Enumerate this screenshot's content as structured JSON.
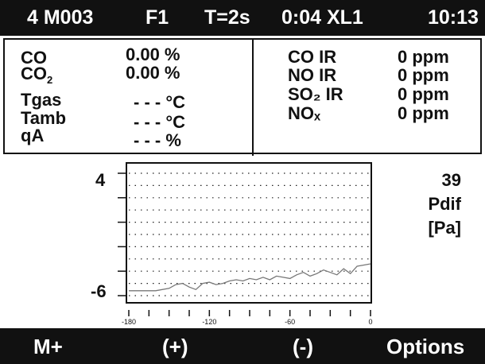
{
  "status": {
    "memory": "4 M003",
    "fuel": "F1",
    "interval": "T=2s",
    "elapsed": "0:04 XL1",
    "clock": "10:13"
  },
  "left_readings": [
    {
      "name": "CO",
      "sub": "",
      "value": "0.00 %"
    },
    {
      "name": "CO",
      "sub": "2",
      "value": "0.00 %"
    },
    {
      "name": "Tgas",
      "sub": "",
      "value": "- - - °C"
    },
    {
      "name": "Tamb",
      "sub": "",
      "value": "- - - °C"
    },
    {
      "name": "qA",
      "sub": "",
      "value": "- - - %"
    }
  ],
  "right_readings": [
    {
      "name": "CO IR",
      "value": "0 ppm"
    },
    {
      "name": "NO IR",
      "value": "0 ppm"
    },
    {
      "name": "SO₂ IR",
      "value": "0 ppm"
    },
    {
      "name": "NOₓ",
      "value": "0 ppm"
    }
  ],
  "graph": {
    "current_value": "39",
    "parameter": "Pdif",
    "unit": "[Pa]"
  },
  "chart_data": {
    "type": "line",
    "x_tick_labels": [
      "-180",
      "-120",
      "-60",
      "0"
    ],
    "y_tick_labels": [
      "4",
      "-6"
    ],
    "xlim": [
      -180,
      0
    ],
    "ylim": [
      -6,
      4
    ],
    "x": [
      -180,
      -170,
      -160,
      -150,
      -145,
      -140,
      -135,
      -130,
      -125,
      -120,
      -115,
      -110,
      -105,
      -100,
      -95,
      -90,
      -85,
      -80,
      -75,
      -70,
      -65,
      -60,
      -55,
      -50,
      -45,
      -40,
      -35,
      -30,
      -25,
      -20,
      -15,
      -10,
      -5,
      0
    ],
    "y": [
      -5.6,
      -5.6,
      -5.6,
      -5.4,
      -5.1,
      -5.0,
      -5.3,
      -5.5,
      -5.0,
      -4.9,
      -5.1,
      -5.0,
      -4.8,
      -4.7,
      -4.8,
      -4.6,
      -4.7,
      -4.5,
      -4.7,
      -4.4,
      -4.5,
      -4.6,
      -4.3,
      -4.1,
      -4.4,
      -4.2,
      -3.9,
      -4.1,
      -4.3,
      -3.8,
      -4.2,
      -3.6,
      -3.5,
      -3.4
    ]
  },
  "footer": {
    "m_plus": "M+",
    "plus": "(+)",
    "minus": "(-)",
    "options": "Options"
  }
}
